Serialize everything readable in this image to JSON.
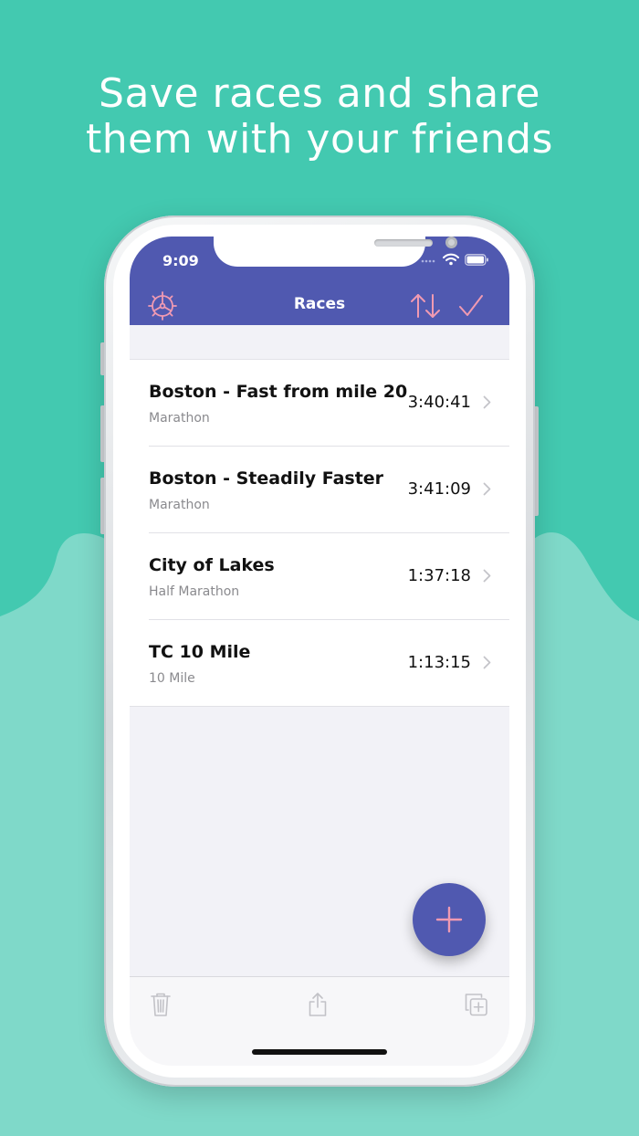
{
  "headline": {
    "line1": "Save races and share",
    "line2": "them with your friends"
  },
  "colors": {
    "background": "#43c9b0",
    "wave": "#7fd9c9",
    "navbar": "#5059b0",
    "accent": "#f09ab2"
  },
  "status_bar": {
    "time": "9:09",
    "icons": [
      "signal-icon",
      "wifi-icon",
      "battery-icon"
    ]
  },
  "nav": {
    "title": "Races",
    "left_icon": "gear-icon",
    "right_icons": [
      "sort-icon",
      "checkmark-icon"
    ]
  },
  "races": [
    {
      "title": "Boston - Fast from mile 20",
      "subtitle": "Marathon",
      "time": "3:40:41"
    },
    {
      "title": "Boston - Steadily Faster",
      "subtitle": "Marathon",
      "time": "3:41:09"
    },
    {
      "title": "City of Lakes",
      "subtitle": "Half Marathon",
      "time": "1:37:18"
    },
    {
      "title": "TC 10 Mile",
      "subtitle": "10 Mile",
      "time": "1:13:15"
    }
  ],
  "fab": {
    "icon": "plus-icon"
  },
  "toolbar": {
    "icons": [
      "trash-icon",
      "share-icon",
      "duplicate-icon"
    ]
  }
}
